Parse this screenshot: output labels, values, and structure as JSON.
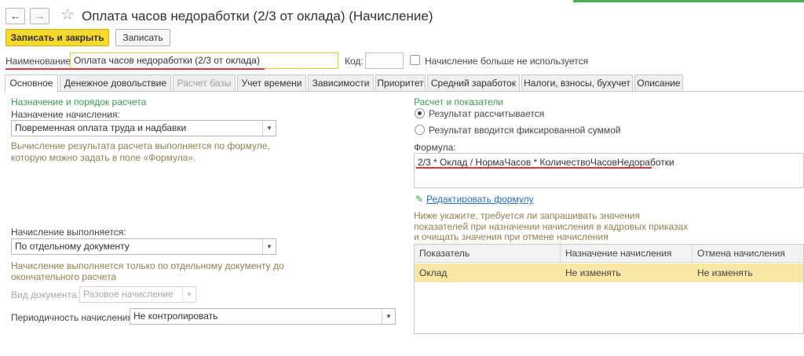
{
  "window": {
    "title": "Оплата часов недоработки (2/3 от оклада) (Начисление)",
    "back_glyph": "←",
    "forward_glyph": "→",
    "favorite_glyph": "☆"
  },
  "toolbar": {
    "save_close_label": "Записать и закрыть",
    "save_label": "Записать"
  },
  "header": {
    "name_label": "Наименование:",
    "name_value": "Оплата часов недоработки (2/3 от оклада)",
    "code_label": "Код:",
    "code_value": "",
    "not_used_label": "Начисление больше не используется"
  },
  "tabs": [
    {
      "label": "Основное",
      "active": true,
      "disabled": false
    },
    {
      "label": "Денежное довольствие",
      "active": false,
      "disabled": false
    },
    {
      "label": "Расчет базы",
      "active": false,
      "disabled": true
    },
    {
      "label": "Учет времени",
      "active": false,
      "disabled": false
    },
    {
      "label": "Зависимости",
      "active": false,
      "disabled": false
    },
    {
      "label": "Приоритет",
      "active": false,
      "disabled": false
    },
    {
      "label": "Средний заработок",
      "active": false,
      "disabled": false
    },
    {
      "label": "Налоги, взносы, бухучет",
      "active": false,
      "disabled": false
    },
    {
      "label": "Описание",
      "active": false,
      "disabled": false
    }
  ],
  "left": {
    "section_title": "Назначение и порядок расчета",
    "purpose_label": "Назначение начисления:",
    "purpose_value": "Повременная оплата труда и надбавки",
    "purpose_hint_1": "Вычисление результата расчета выполняется по формуле,",
    "purpose_hint_2": "которую можно задать в поле «Формула».",
    "performed_label": "Начисление выполняется:",
    "performed_value": "По отдельному документу",
    "performed_hint_1": "Начисление выполняется только по отдельному документу до",
    "performed_hint_2": "окончательного расчета",
    "doc_type_label": "Вид документа:",
    "doc_type_value": "Разовое начисление",
    "periodicity_label": "Периодичность начисления:",
    "periodicity_value": "Не контролировать"
  },
  "right": {
    "section_title": "Расчет и показатели",
    "radio_calculated": "Результат рассчитывается",
    "radio_fixed": "Результат вводится фиксированной суммой",
    "formula_label": "Формула:",
    "formula_value": "2/3 * Оклад / НормаЧасов * КоличествоЧасовНедоработки",
    "edit_formula_link": "Редактировать формулу",
    "hint_1": "Ниже укажите, требуется ли запрашивать значения",
    "hint_2": "показателей при назначении начисления в кадровых приказах",
    "hint_3": "и очищать значения при отмене начисления"
  },
  "table": {
    "columns": [
      "Показатель",
      "Назначение начисления",
      "Отмена начисления"
    ],
    "rows": [
      [
        "Оклад",
        "Не изменять",
        "Не изменять"
      ]
    ]
  },
  "colors": {
    "accent_yellow": "#f6d82e",
    "section_green": "#3c9a52",
    "hint_brown": "#8f7f4f",
    "link_blue": "#2a6bb7",
    "underline_red": "#e0373c",
    "selected_row": "#f9e7a8"
  },
  "icons": {
    "back": "arrow-left-icon",
    "forward": "arrow-right-icon",
    "favorite": "star-icon",
    "edit": "pencil-icon",
    "dropdown": "chevron-down-icon"
  }
}
